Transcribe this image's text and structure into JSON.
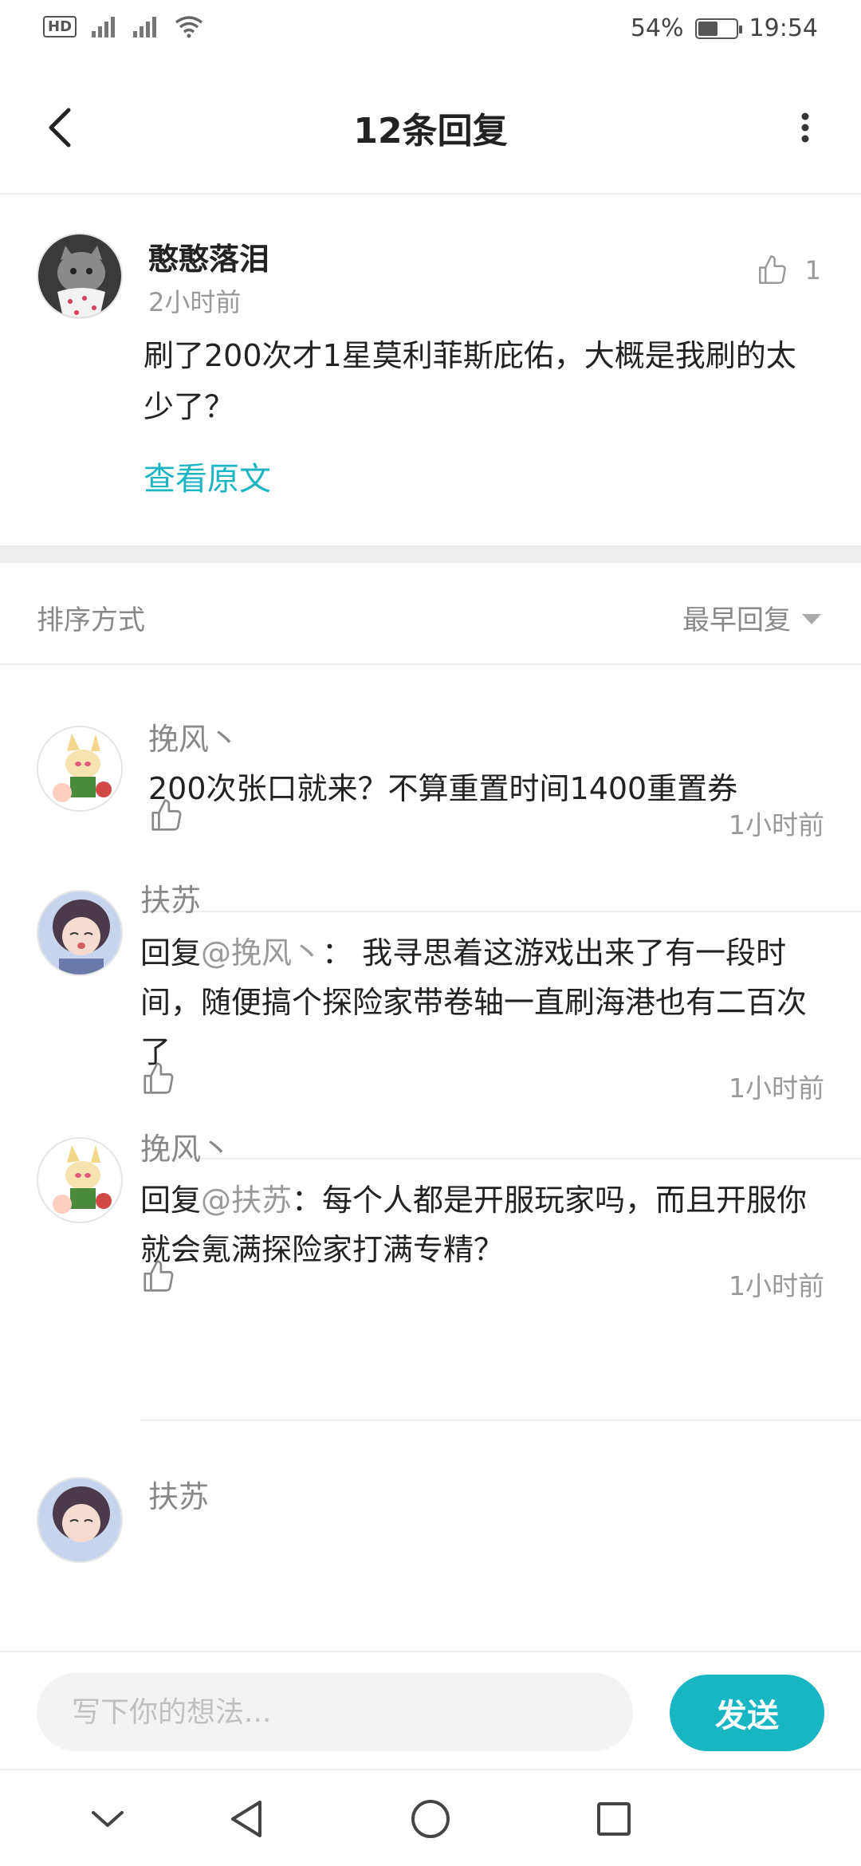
{
  "status_bar": {
    "hd_label": "HD",
    "battery_text": "54%",
    "battery_level": 0.54,
    "time": "19:54"
  },
  "header": {
    "title": "12条回复",
    "back_icon": "chevron-left-icon",
    "more_icon": "more-vertical-icon"
  },
  "original": {
    "username": "憨憨落泪",
    "time": "2小时前",
    "like_count": "1",
    "text": "刷了200次才1星莫利菲斯庇佑，大概是我刷的太少了？",
    "view_original": "查看原文"
  },
  "sort": {
    "label": "排序方式",
    "selected": "最早回复"
  },
  "replies": [
    {
      "username": "挽风丶",
      "text": "200次张口就来？不算重置时间1400重置券",
      "time": "1小时前"
    },
    {
      "username": "扶苏",
      "reply_prefix": "回复",
      "mention": "@挽风丶",
      "text": "：  我寻思着这游戏出来了有一段时间，随便搞个探险家带卷轴一直刷海港也有二百次了",
      "time": "1小时前"
    },
    {
      "username": "挽风丶",
      "reply_prefix": "回复",
      "mention": "@扶苏",
      "text": "：每个人都是开服玩家吗，而且开服你就会氪满探险家打满专精？",
      "time": "1小时前"
    },
    {
      "username": "扶苏"
    }
  ],
  "composer": {
    "placeholder": "写下你的想法...",
    "send_label": "发送"
  },
  "colors": {
    "accent": "#18b5c2",
    "link": "#1eb5c2",
    "divider": "#eeeeee"
  }
}
